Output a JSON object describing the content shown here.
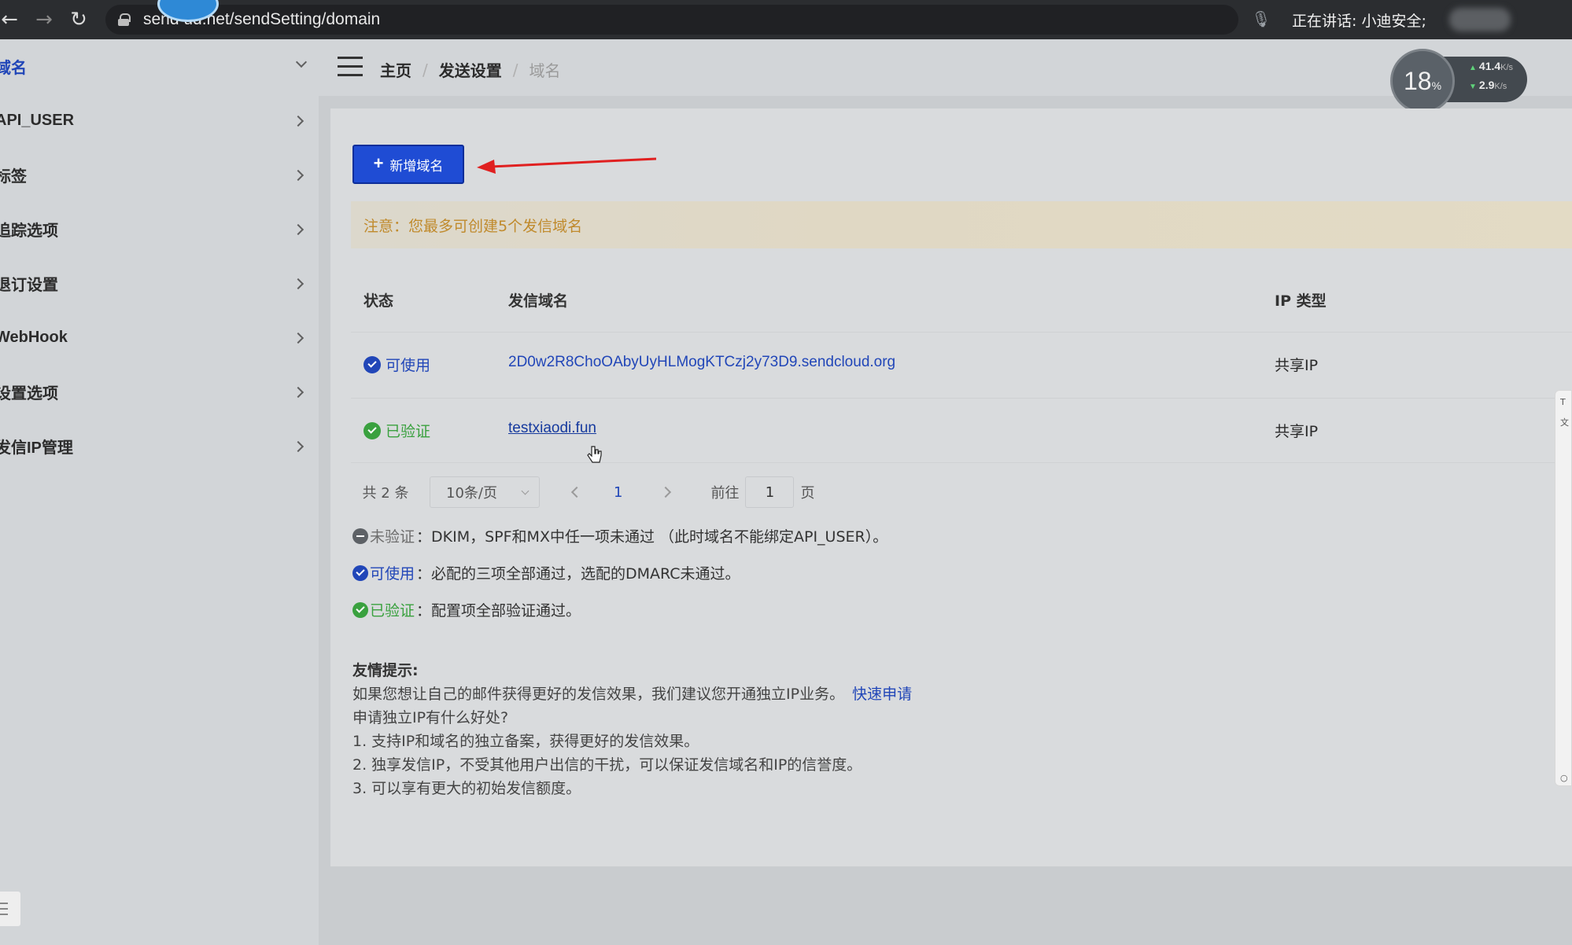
{
  "browser": {
    "url": "send   ud.net/sendSetting/domain",
    "speaking": "正在讲话: 小迪安全;"
  },
  "sidebar": {
    "items": [
      {
        "label": "域名",
        "active": true,
        "icon": "chevron-down-icon"
      },
      {
        "label": "API_USER",
        "icon": "chevron-right-icon"
      },
      {
        "label": "标签",
        "icon": "chevron-right-icon"
      },
      {
        "label": "追踪选项",
        "icon": "chevron-right-icon"
      },
      {
        "label": "退订设置",
        "icon": "chevron-right-icon"
      },
      {
        "label": "WebHook",
        "icon": "chevron-right-icon"
      },
      {
        "label": "设置选项",
        "icon": "chevron-right-icon"
      },
      {
        "label": "发信IP管理",
        "icon": "chevron-right-icon"
      }
    ]
  },
  "header": {
    "breadcrumb": [
      "主页",
      "发送设置",
      "域名"
    ],
    "separator": "/"
  },
  "monitor": {
    "cpu_value": "18",
    "cpu_unit": "%",
    "upload": "41.4",
    "download": "2.9",
    "unit": "K/s"
  },
  "toolbar": {
    "add_label": "新增域名"
  },
  "notice": "注意：您最多可创建5个发信域名",
  "table": {
    "headers": {
      "status": "状态",
      "domain": "发信域名",
      "ip_type": "IP 类型"
    },
    "rows": [
      {
        "status": "可使用",
        "status_icon": "check-circle-icon",
        "domain": "2D0w2R8ChoOAbyUyHLMogKTCzj2y73D9.sendcloud.org",
        "ip_type": "共享IP"
      },
      {
        "status": "已验证",
        "status_icon": "shield-check-icon",
        "domain": "testxiaodi.fun",
        "ip_type": "共享IP"
      }
    ]
  },
  "pagination": {
    "total": "共 2 条",
    "page_size": "10条/页",
    "current_page": "1",
    "goto_label": "前往",
    "goto_value": "1",
    "unit": "页"
  },
  "legend": [
    {
      "label": "未验证",
      "text": "：DKIM，SPF和MX中任一项未通过 （此时域名不能绑定API_USER）。"
    },
    {
      "label": "可使用",
      "text": "：必配的三项全部通过，选配的DMARC未通过。"
    },
    {
      "label": "已验证",
      "text": "：配置项全部验证通过。"
    }
  ],
  "tips": {
    "title": "友情提示:",
    "line1": "如果您想让自己的邮件获得更好的发信效果，我们建议您开通独立IP业务。",
    "apply_link": "快速申请",
    "line2": "申请独立IP有什么好处?",
    "benefits": [
      "1. 支持IP和域名的独立备案，获得更好的发信效果。",
      "2. 独享发信IP，不受其他用户出信的干扰，可以保证发信域名和IP的信誉度。",
      "3. 可以享有更大的初始发信额度。"
    ]
  },
  "colors": {
    "primary": "#1f4cd4",
    "link": "#2146b8",
    "success": "#3aa13f",
    "warning": "#c08a2c",
    "annotation_arrow": "#e02020"
  }
}
